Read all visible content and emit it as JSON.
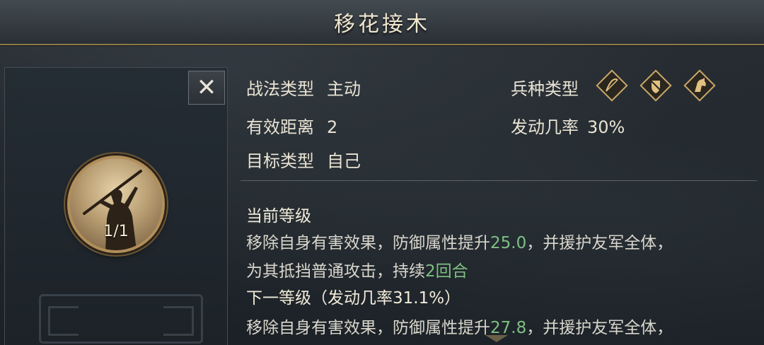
{
  "title": "移花接木",
  "portrait": {
    "level": "1/1",
    "icon": "warrior-spear-icon"
  },
  "close": {
    "label": "✕"
  },
  "info": {
    "tactic_type_label": "战法类型",
    "tactic_type_value": "主动",
    "range_label": "有效距离",
    "range_value": "2",
    "target_label": "目标类型",
    "target_value": "自己",
    "unit_type_label": "兵种类型",
    "unit_icons": [
      "bow-icon",
      "shield-icon",
      "horse-icon"
    ],
    "trigger_label": "发动几率",
    "trigger_value": "30%"
  },
  "current": {
    "heading": "当前等级",
    "line1_a": "移除自身有害效果，防御属性提升",
    "line1_num": "25.0",
    "line1_b": "，并援护友军全体，",
    "line2_a": "为其抵挡普通攻击，持续",
    "line2_num": "2回合"
  },
  "next": {
    "heading": "下一等级（发动几率31.1%）",
    "line1_a": "移除自身有害效果，防御属性提升",
    "line1_num": "27.8",
    "line1_b": "，并援护友军全体，"
  },
  "colors": {
    "accent_gold": "#b18e5a",
    "value_green": "#7fbf83"
  }
}
